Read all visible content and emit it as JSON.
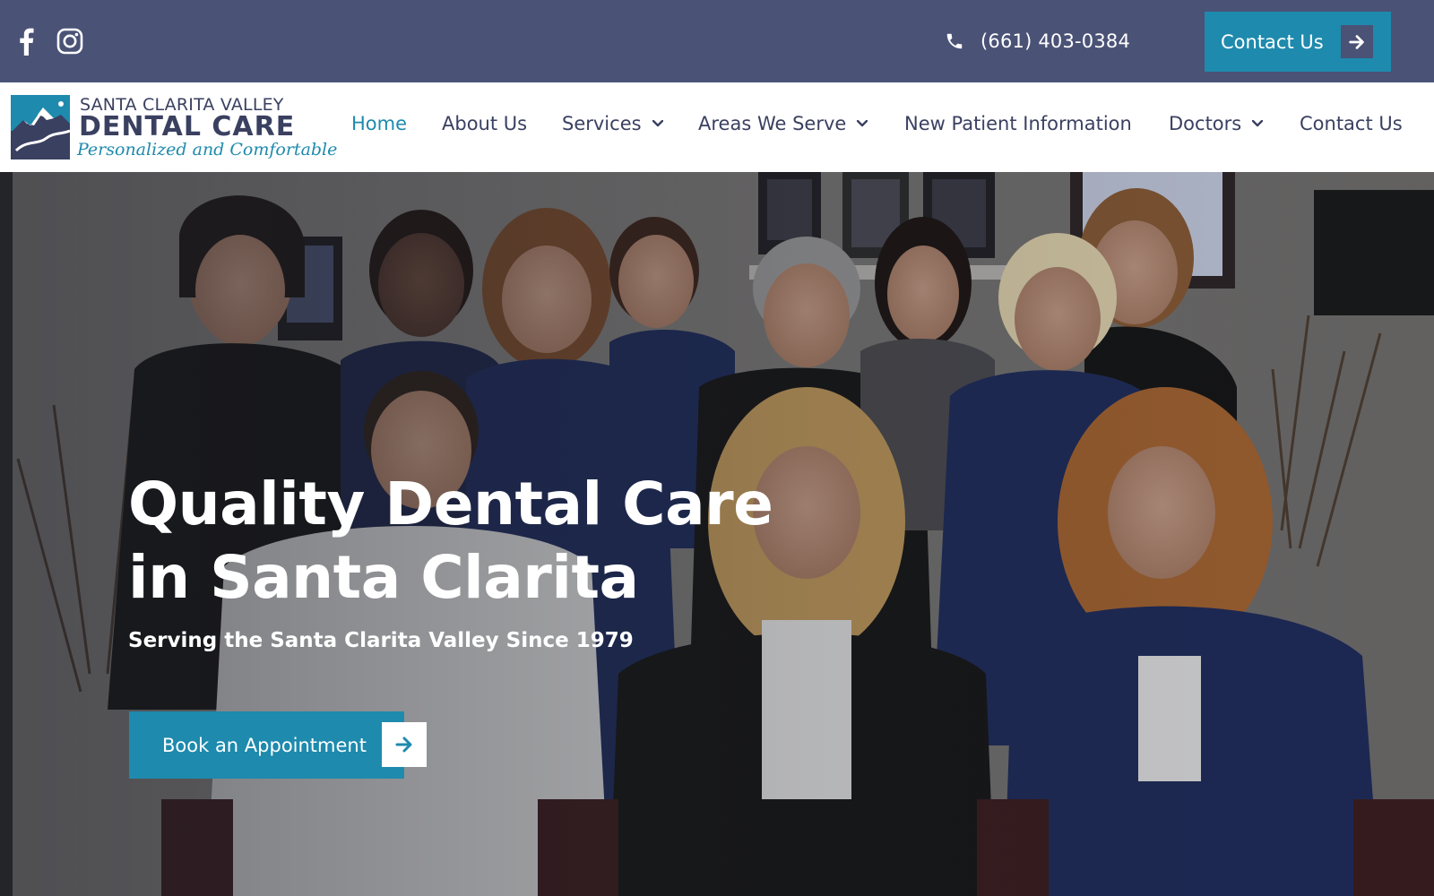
{
  "topbar": {
    "social": [
      {
        "icon": "facebook-icon"
      },
      {
        "icon": "instagram-icon"
      }
    ],
    "phone": {
      "icon": "phone-icon",
      "text": "(661) 403-0384"
    },
    "cta": {
      "label": "Contact Us",
      "icon": "arrow-right-icon"
    }
  },
  "logo": {
    "line1": "SANTA CLARITA VALLEY",
    "line2": "DENTAL CARE",
    "line3": "Personalized and Comfortable"
  },
  "nav": {
    "items": [
      {
        "label": "Home",
        "active": true,
        "dropdown": false
      },
      {
        "label": "About Us",
        "active": false,
        "dropdown": false
      },
      {
        "label": "Services",
        "active": false,
        "dropdown": true
      },
      {
        "label": "Areas We Serve",
        "active": false,
        "dropdown": true
      },
      {
        "label": "New Patient Information",
        "active": false,
        "dropdown": false
      },
      {
        "label": "Doctors",
        "active": false,
        "dropdown": true
      },
      {
        "label": "Contact Us",
        "active": false,
        "dropdown": false
      }
    ]
  },
  "hero": {
    "title_line1": "Quality Dental Care",
    "title_line2": "in Santa Clarita",
    "subtitle": "Serving the Santa Clarita Valley Since 1979",
    "cta": {
      "label": "Book an Appointment",
      "icon": "arrow-right-icon"
    }
  },
  "colors": {
    "topbar_bg": "#4a5276",
    "accent": "#1e8aad",
    "nav_text": "#3a4060"
  }
}
